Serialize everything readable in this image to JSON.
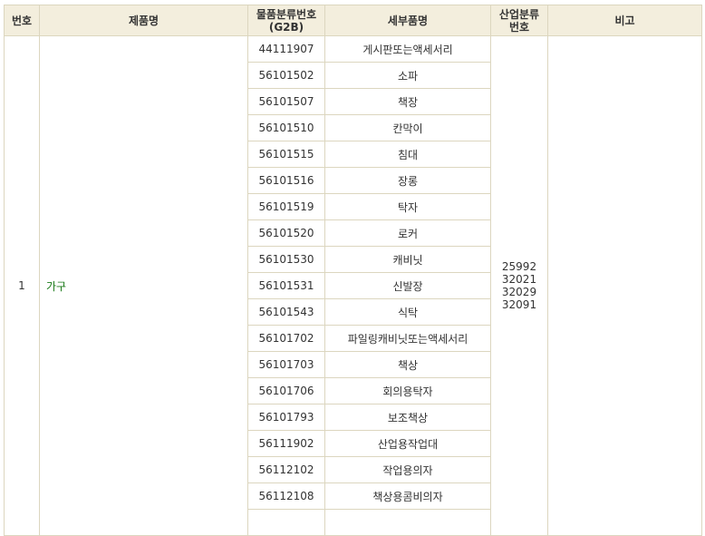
{
  "headers": {
    "no": "번호",
    "product": "제품명",
    "g2b_line1": "물품분류번호",
    "g2b_line2": "(G2B)",
    "detail": "세부품명",
    "ind_line1": "산업분류",
    "ind_line2": "번호",
    "note": "비고"
  },
  "group": {
    "no": "1",
    "name": "가구",
    "industry_codes": [
      "25992",
      "32021",
      "32029",
      "32091"
    ],
    "note": ""
  },
  "rows": [
    {
      "code": "44111907",
      "name": "게시판또는액세서리"
    },
    {
      "code": "56101502",
      "name": "소파"
    },
    {
      "code": "56101507",
      "name": "책장"
    },
    {
      "code": "56101510",
      "name": "칸막이"
    },
    {
      "code": "56101515",
      "name": "침대"
    },
    {
      "code": "56101516",
      "name": "장롱"
    },
    {
      "code": "56101519",
      "name": "탁자"
    },
    {
      "code": "56101520",
      "name": "로커"
    },
    {
      "code": "56101530",
      "name": "캐비닛"
    },
    {
      "code": "56101531",
      "name": "신발장"
    },
    {
      "code": "56101543",
      "name": "식탁"
    },
    {
      "code": "56101702",
      "name": "파일링캐비닛또는액세서리"
    },
    {
      "code": "56101703",
      "name": "책상"
    },
    {
      "code": "56101706",
      "name": "회의용탁자"
    },
    {
      "code": "56101793",
      "name": "보조책상"
    },
    {
      "code": "56111902",
      "name": "산업용작업대"
    },
    {
      "code": "56112102",
      "name": "작업용의자"
    },
    {
      "code": "56112108",
      "name": "책상용콤비의자"
    }
  ],
  "colors": {
    "header_bg": "#f3eedd",
    "border": "#dcd6bf",
    "group_text": "#1a7a18"
  }
}
